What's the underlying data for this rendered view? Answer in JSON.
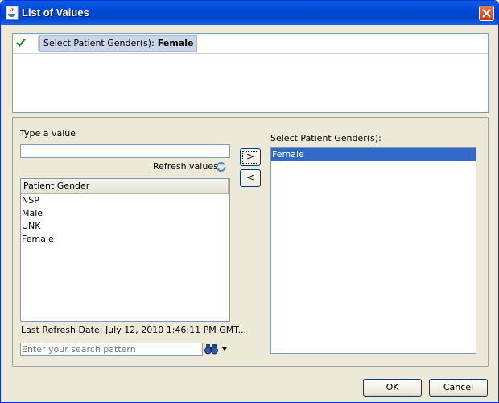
{
  "window": {
    "title": "List of Values",
    "icon": "java-cup-icon"
  },
  "condition": {
    "label": "Select Patient Gender(s):",
    "value": "Female"
  },
  "left": {
    "type_label": "Type a value",
    "type_value": "",
    "refresh_label": "Refresh values",
    "column_header": "Patient Gender",
    "items": [
      "NSP",
      "Male",
      "UNK",
      "Female"
    ],
    "last_refresh": "Last Refresh Date: July 12, 2010 1:46:11 PM GMT...",
    "search_placeholder": "Enter your search pattern"
  },
  "move": {
    "add": ">",
    "remove": "<"
  },
  "right": {
    "label": "Select Patient Gender(s):",
    "items": [
      "Female"
    ]
  },
  "buttons": {
    "ok": "OK",
    "cancel": "Cancel"
  },
  "colors": {
    "titlebar": "#0148d8",
    "selection": "#316ac5",
    "check": "#2a8a2a",
    "dialog_bg": "#ece9d8"
  }
}
